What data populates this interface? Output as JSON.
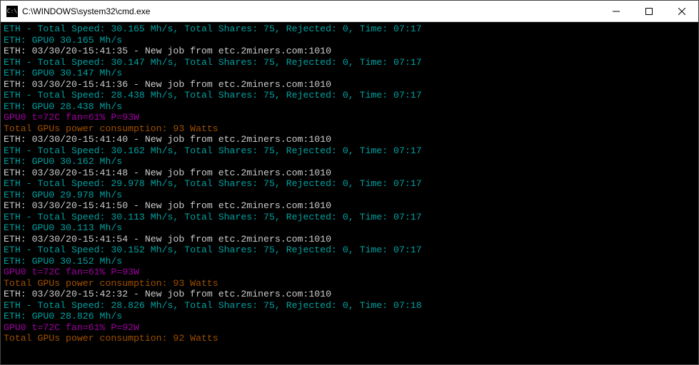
{
  "titlebar": {
    "icon_label": "C:\\",
    "title": "C:\\WINDOWS\\system32\\cmd.exe"
  },
  "colors": {
    "cyan": "#00a0a0",
    "white": "#cccccc",
    "purple": "#a000a0",
    "orange": "#a05000"
  },
  "lines": [
    {
      "color": "cyan",
      "text": "ETH - Total Speed: 30.165 Mh/s, Total Shares: 75, Rejected: 0, Time: 07:17"
    },
    {
      "color": "cyan",
      "text": "ETH: GPU0 30.165 Mh/s"
    },
    {
      "color": "white",
      "text": "ETH: 03/30/20-15:41:35 - New job from etc.2miners.com:1010"
    },
    {
      "color": "cyan",
      "text": "ETH - Total Speed: 30.147 Mh/s, Total Shares: 75, Rejected: 0, Time: 07:17"
    },
    {
      "color": "cyan",
      "text": "ETH: GPU0 30.147 Mh/s"
    },
    {
      "color": "white",
      "text": "ETH: 03/30/20-15:41:36 - New job from etc.2miners.com:1010"
    },
    {
      "color": "cyan",
      "text": "ETH - Total Speed: 28.438 Mh/s, Total Shares: 75, Rejected: 0, Time: 07:17"
    },
    {
      "color": "cyan",
      "text": "ETH: GPU0 28.438 Mh/s"
    },
    {
      "color": "purple",
      "text": "GPU0 t=72C fan=61% P=93W"
    },
    {
      "color": "orange",
      "text": "Total GPUs power consumption: 93 Watts"
    },
    {
      "color": "white",
      "text": "ETH: 03/30/20-15:41:40 - New job from etc.2miners.com:1010"
    },
    {
      "color": "cyan",
      "text": "ETH - Total Speed: 30.162 Mh/s, Total Shares: 75, Rejected: 0, Time: 07:17"
    },
    {
      "color": "cyan",
      "text": "ETH: GPU0 30.162 Mh/s"
    },
    {
      "color": "white",
      "text": "ETH: 03/30/20-15:41:48 - New job from etc.2miners.com:1010"
    },
    {
      "color": "cyan",
      "text": "ETH - Total Speed: 29.978 Mh/s, Total Shares: 75, Rejected: 0, Time: 07:17"
    },
    {
      "color": "cyan",
      "text": "ETH: GPU0 29.978 Mh/s"
    },
    {
      "color": "white",
      "text": "ETH: 03/30/20-15:41:50 - New job from etc.2miners.com:1010"
    },
    {
      "color": "cyan",
      "text": "ETH - Total Speed: 30.113 Mh/s, Total Shares: 75, Rejected: 0, Time: 07:17"
    },
    {
      "color": "cyan",
      "text": "ETH: GPU0 30.113 Mh/s"
    },
    {
      "color": "white",
      "text": "ETH: 03/30/20-15:41:54 - New job from etc.2miners.com:1010"
    },
    {
      "color": "cyan",
      "text": "ETH - Total Speed: 30.152 Mh/s, Total Shares: 75, Rejected: 0, Time: 07:17"
    },
    {
      "color": "cyan",
      "text": "ETH: GPU0 30.152 Mh/s"
    },
    {
      "color": "purple",
      "text": "GPU0 t=72C fan=61% P=93W"
    },
    {
      "color": "orange",
      "text": "Total GPUs power consumption: 93 Watts"
    },
    {
      "color": "white",
      "text": "ETH: 03/30/20-15:42:32 - New job from etc.2miners.com:1010"
    },
    {
      "color": "cyan",
      "text": "ETH - Total Speed: 28.826 Mh/s, Total Shares: 75, Rejected: 0, Time: 07:18"
    },
    {
      "color": "cyan",
      "text": "ETH: GPU0 28.826 Mh/s"
    },
    {
      "color": "purple",
      "text": "GPU0 t=72C fan=61% P=92W"
    },
    {
      "color": "orange",
      "text": "Total GPUs power consumption: 92 Watts"
    }
  ]
}
